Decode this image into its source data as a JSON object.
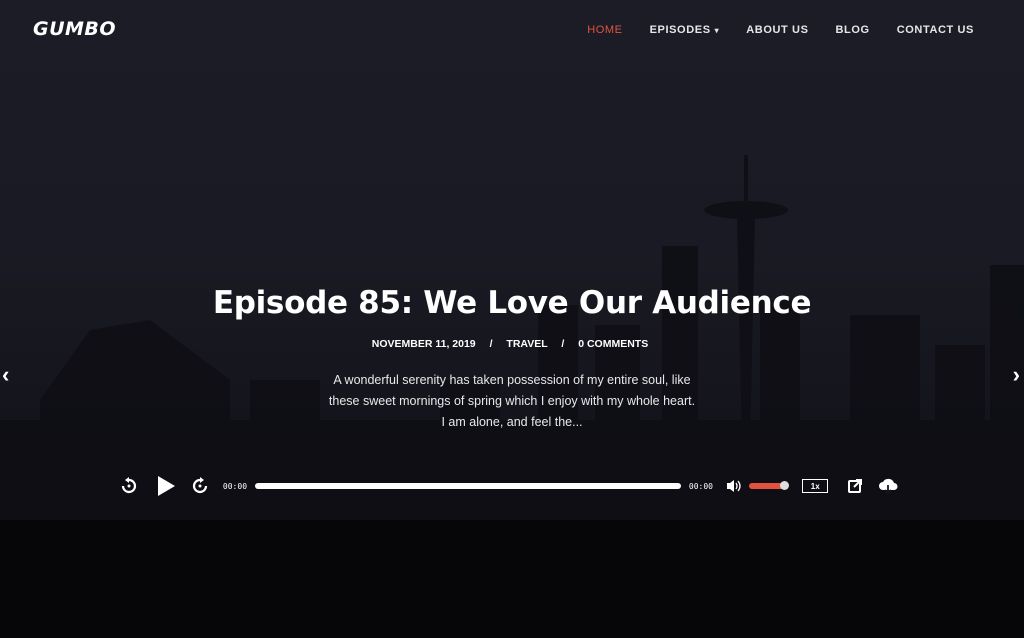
{
  "site": {
    "logo": "GUMBO"
  },
  "nav": {
    "items": [
      {
        "label": "HOME",
        "active": true
      },
      {
        "label": "EPISODES",
        "has_dropdown": true
      },
      {
        "label": "ABOUT US"
      },
      {
        "label": "BLOG"
      },
      {
        "label": "CONTACT US"
      }
    ],
    "dropdown_icon": "▾"
  },
  "hero": {
    "title": "Episode 85: We Love Our Audience",
    "meta": {
      "date": "NOVEMBER 11, 2019",
      "category": "TRAVEL",
      "comments": "0 COMMENTS",
      "separator": "/"
    },
    "excerpt_lines": [
      "A wonderful serenity has taken possession of my entire soul, like",
      "these sweet mornings of spring which I enjoy with my whole heart.",
      "I am alone, and feel the..."
    ]
  },
  "player": {
    "current_time": "00:00",
    "duration": "00:00",
    "progress": 0,
    "volume": 1.0,
    "speed": "1x",
    "icons": [
      "rewind-icon",
      "play-icon",
      "forward-icon",
      "volume-icon",
      "share-icon",
      "download-icon"
    ]
  },
  "slider": {
    "prev": "‹",
    "next": "›"
  },
  "colors": {
    "accent": "#e2533f",
    "background": "#1a1a24",
    "text": "#ffffff"
  }
}
